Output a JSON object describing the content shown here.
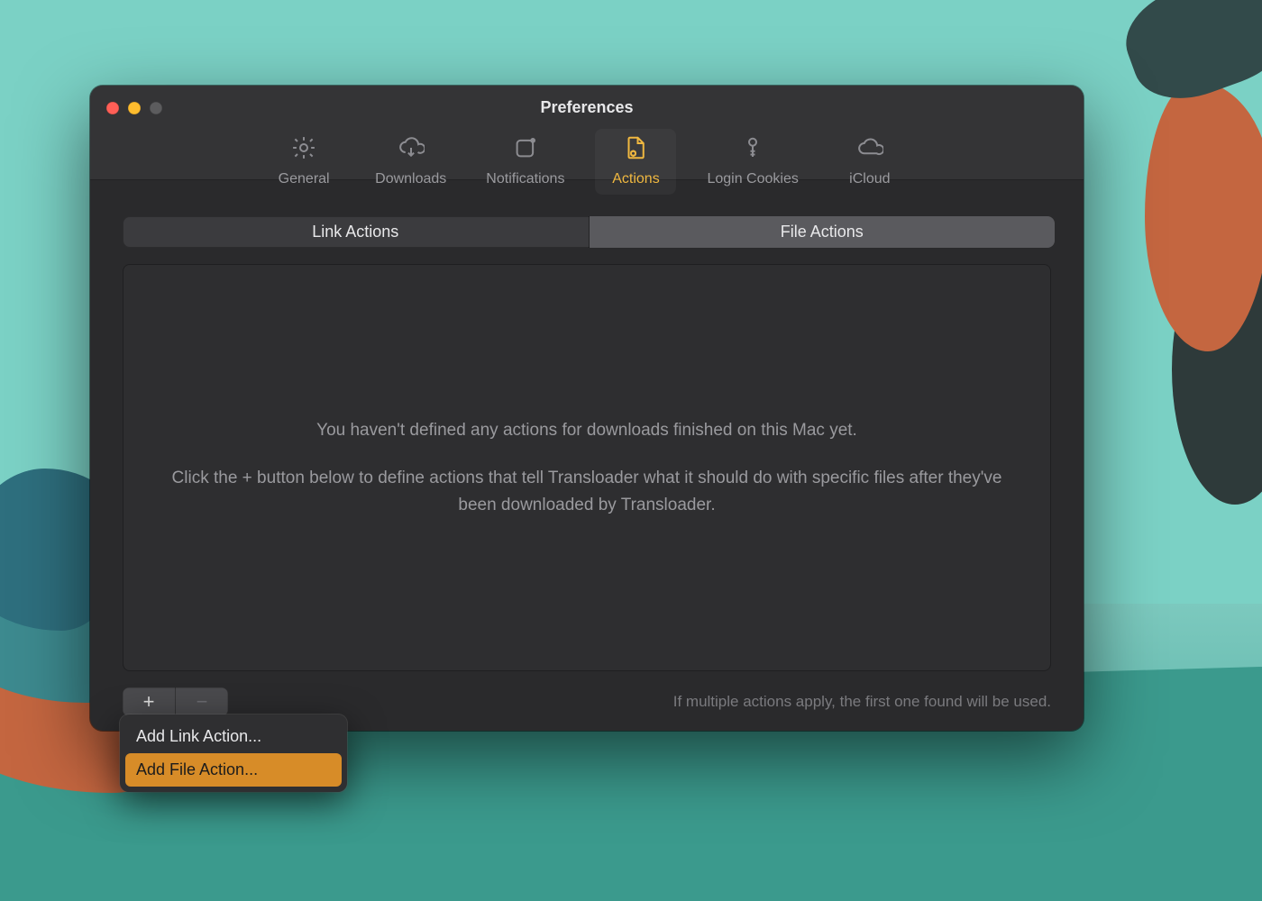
{
  "window": {
    "title": "Preferences"
  },
  "toolbar": {
    "items": [
      {
        "label": "General"
      },
      {
        "label": "Downloads"
      },
      {
        "label": "Notifications"
      },
      {
        "label": "Actions"
      },
      {
        "label": "Login Cookies"
      },
      {
        "label": "iCloud"
      }
    ],
    "selected_index": 3
  },
  "segments": {
    "items": [
      {
        "label": "Link Actions"
      },
      {
        "label": "File Actions"
      }
    ],
    "selected_index": 1
  },
  "empty_state": {
    "line1": "You haven't defined any actions for downloads finished on this Mac yet.",
    "line2": "Click the + button below to define actions that tell Transloader what it should do with specific files after they've been downloaded by Transloader."
  },
  "footer": {
    "note": "If multiple actions apply, the first one found will be used.",
    "plus": "+",
    "minus": "−"
  },
  "popup_menu": {
    "items": [
      {
        "label": "Add Link Action..."
      },
      {
        "label": "Add File Action..."
      }
    ],
    "highlighted_index": 1
  },
  "colors": {
    "accent": "#f0b840"
  }
}
